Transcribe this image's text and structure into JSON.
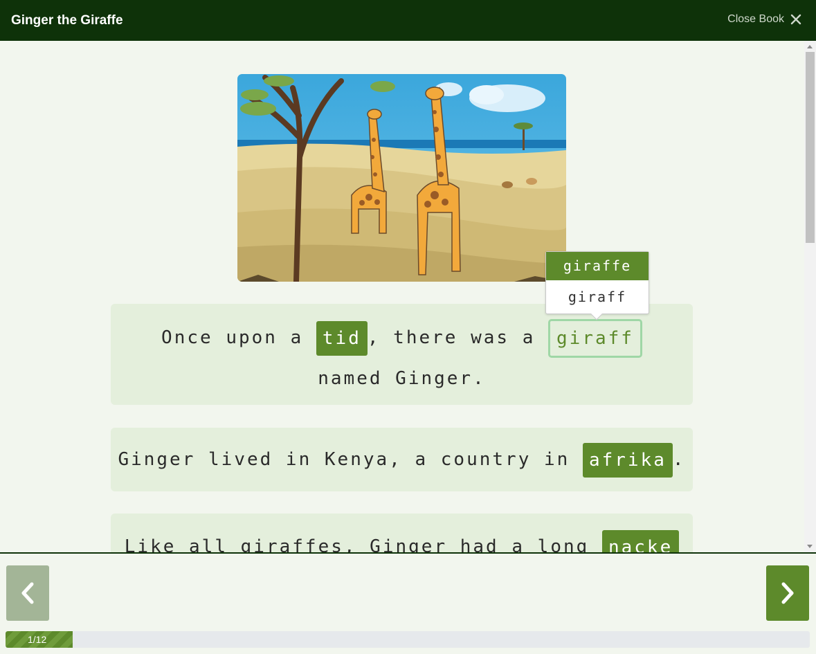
{
  "header": {
    "title": "Ginger the Giraffe",
    "close_label": "Close Book",
    "close_icon": "close-icon"
  },
  "sentences": [
    {
      "before": "Once upon a ",
      "error1": "tid",
      "middle": ", there was a ",
      "error2": "giraff",
      "after": "named Ginger."
    },
    {
      "before": "Ginger lived in Kenya, a country in ",
      "error1": "afrika",
      "after": "."
    },
    {
      "before": "Like all giraffes, Ginger had a long ",
      "error1": "nacke"
    }
  ],
  "suggestion_popup": {
    "options": [
      "giraffe",
      "giraff"
    ]
  },
  "progress": {
    "label": "1/12",
    "current": 1,
    "total": 12,
    "fraction": 0.0833
  },
  "colors": {
    "header_bg": "#0e3209",
    "accent": "#5d8a2b",
    "selected_border": "#9fd7a6",
    "sentence_bg": "#e4efdc",
    "page_bg": "#f2f6ee"
  }
}
